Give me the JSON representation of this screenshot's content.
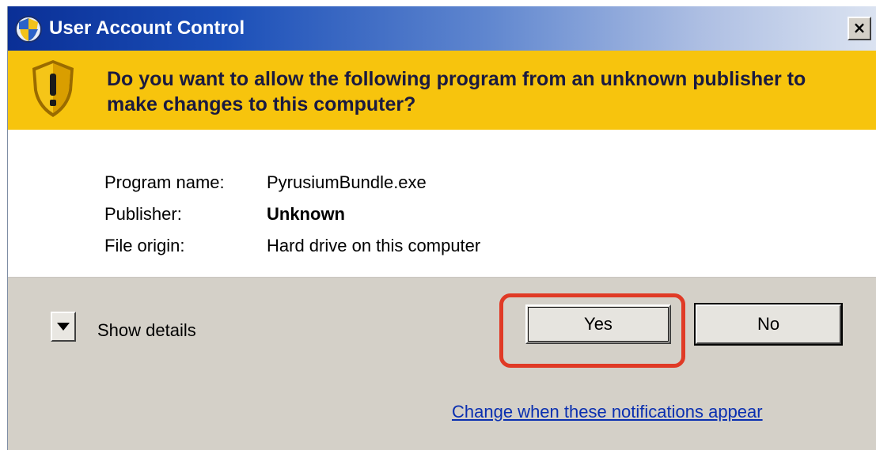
{
  "window": {
    "title": "User Account Control",
    "close_glyph": "×"
  },
  "banner": {
    "headline": "Do you want to allow the following program from an unknown publisher to make changes to this computer?",
    "icon": "warning-shield-icon",
    "color": "#f7c40d"
  },
  "details": {
    "rows": [
      {
        "label": "Program name:",
        "value": "PyrusiumBundle.exe"
      },
      {
        "label": "Publisher:",
        "value": "Unknown"
      },
      {
        "label": "File origin:",
        "value": "Hard drive on this computer"
      }
    ]
  },
  "footer": {
    "show_details": "Show details",
    "yes": "Yes",
    "no": "No",
    "change_link": "Change when these notifications appear",
    "highlight_color": "#e03a26"
  }
}
